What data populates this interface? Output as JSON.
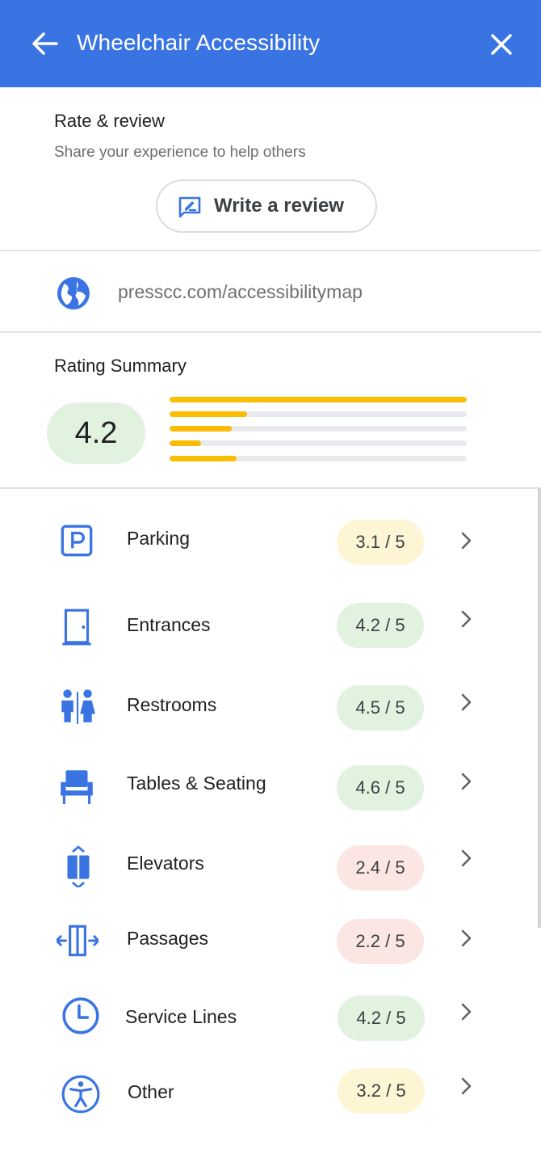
{
  "header": {
    "title": "Wheelchair Accessibility",
    "background": "#3a74e2",
    "back_icon": "arrow-back-icon",
    "close_icon": "close-icon"
  },
  "review": {
    "title": "Rate & review",
    "subtitle": "Share your experience to help others",
    "button_label": "Write a review",
    "button_icon": "rate-review-icon"
  },
  "website": {
    "icon": "globe-icon",
    "url": "presscc.com/accessibilitymap"
  },
  "summary": {
    "title": "Rating Summary",
    "score": "4.2",
    "bar_color": "#fbbc04",
    "bars": [
      {
        "fraction": 1.0
      },
      {
        "fraction": 0.26
      },
      {
        "fraction": 0.21
      },
      {
        "fraction": 0.105
      },
      {
        "fraction": 0.225
      }
    ]
  },
  "categories": [
    {
      "label": "Parking",
      "rating": "3.1 / 5",
      "tone": "yellow",
      "icon": "parking-icon"
    },
    {
      "label": "Entrances",
      "rating": "4.2 / 5",
      "tone": "green",
      "icon": "door-icon"
    },
    {
      "label": "Restrooms",
      "rating": "4.5 / 5",
      "tone": "green",
      "icon": "restroom-icon"
    },
    {
      "label": "Tables & Seating",
      "rating": "4.6 / 5",
      "tone": "green",
      "icon": "seat-icon"
    },
    {
      "label": "Elevators",
      "rating": "2.4 / 5",
      "tone": "red",
      "icon": "elevator-icon"
    },
    {
      "label": "Passages",
      "rating": "2.2 / 5",
      "tone": "red",
      "icon": "passage-icon"
    },
    {
      "label": "Service Lines",
      "rating": "4.2 / 5",
      "tone": "green",
      "icon": "clock-icon"
    },
    {
      "label": "Other",
      "rating": "3.2 / 5",
      "tone": "yellow",
      "icon": "accessibility-icon"
    }
  ],
  "colors": {
    "accent": "#3a74e2",
    "pill_yellow": "#fdf5d3",
    "pill_green": "#e1f2df",
    "pill_red": "#fce6e4"
  }
}
